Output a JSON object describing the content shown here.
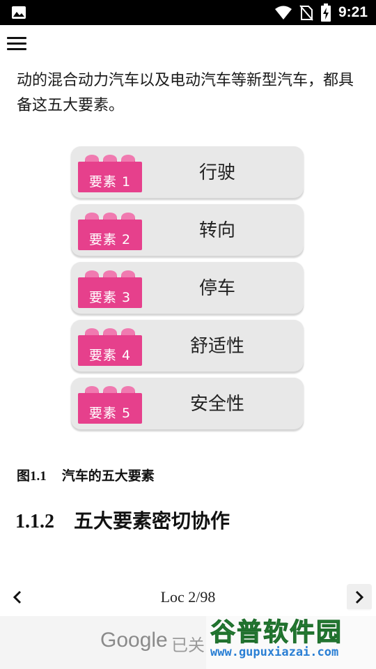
{
  "status_bar": {
    "time": "9:21",
    "icons": [
      "image-icon",
      "wifi-icon",
      "no-sim-icon",
      "battery-charging-icon"
    ]
  },
  "app_bar": {
    "menu_icon": "hamburger-menu-icon"
  },
  "reader": {
    "paragraph": "动的混合动力汽车以及电动汽车等新型汽车，都具备这五大要素。",
    "figure": {
      "elements": [
        {
          "label": "要素 1",
          "name": "行驶"
        },
        {
          "label": "要素 2",
          "name": "转向"
        },
        {
          "label": "要素 3",
          "name": "停车"
        },
        {
          "label": "要素 4",
          "name": "舒适性"
        },
        {
          "label": "要素 5",
          "name": "安全性"
        }
      ],
      "colors": {
        "brick": "#e6408c",
        "stud": "#f07ab0",
        "pill": "#e8e8e8"
      }
    },
    "caption_number": "图1.1",
    "caption_text": "汽车的五大要素",
    "section_number": "1.1.2",
    "section_title": "五大要素密切协作"
  },
  "navigation": {
    "location": "Loc 2/98",
    "prev_icon": "chevron-left-icon",
    "next_icon": "chevron-right-icon"
  },
  "ad_bar": {
    "brand": "Google",
    "status_text": "已关"
  },
  "watermark": {
    "title": "谷普软件园",
    "url": "www.gupuxiazai.com"
  }
}
